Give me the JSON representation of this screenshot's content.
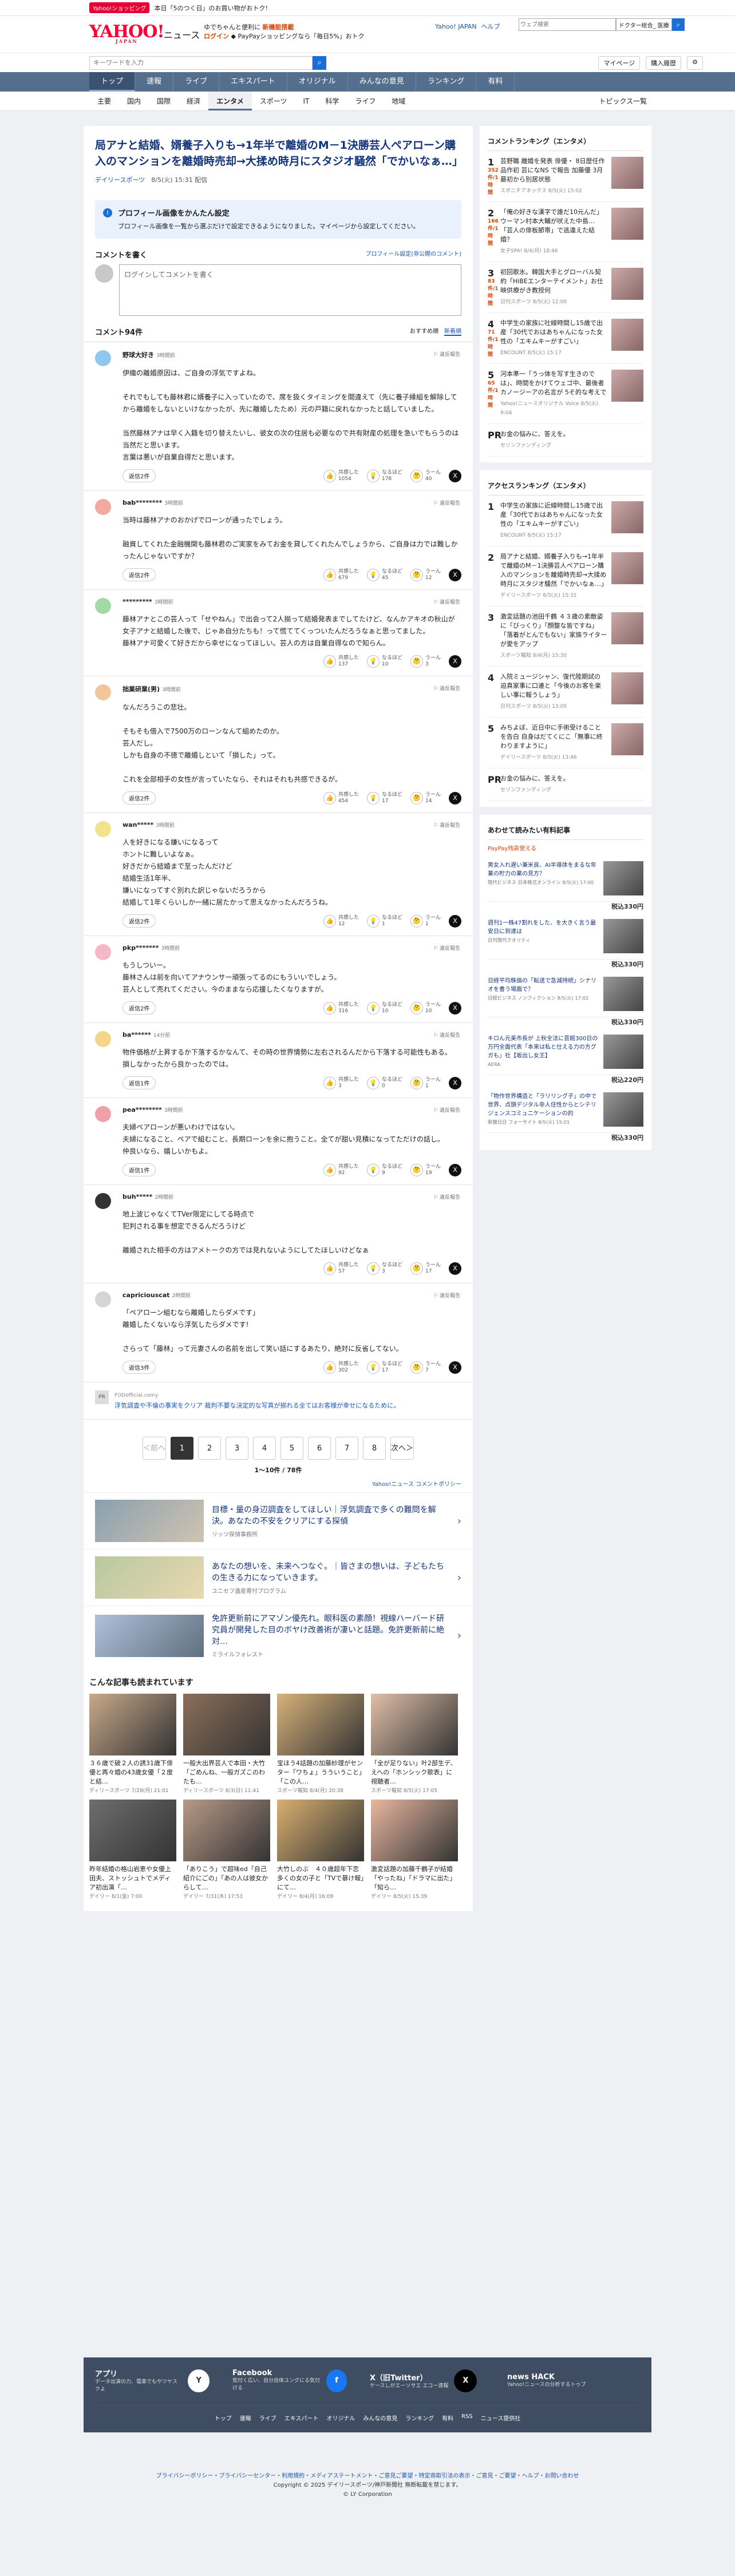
{
  "promo": {
    "tag": "Yahoo!ショッピング",
    "text": "本日「5のつく日」のお買い物がおトク!"
  },
  "header": {
    "logo": "YAHOO!",
    "logo_sub": "JAPAN",
    "service": "ニュース",
    "promo1": "ゆでちゃんと便利に",
    "promo1b": "新機能搭載",
    "promo2": "ログイン",
    "promo2b": "PayPayショッピングなら「毎日5%」おトク",
    "links": [
      "Yahoo! JAPAN",
      "ヘルプ"
    ],
    "search_placeholder": "ウェブ検索",
    "search_btn_text": "ドクター総合_ 医療"
  },
  "subbar": {
    "placeholder": "キーワードを入力",
    "mypage": "マイページ",
    "buy": "購入履歴"
  },
  "gnav": [
    "トップ",
    "速報",
    "ライブ",
    "エキスパート",
    "オリジナル",
    "みんなの意見",
    "ランキング",
    "有料"
  ],
  "cnav": [
    "主要",
    "国内",
    "国際",
    "経済",
    "エンタメ",
    "スポーツ",
    "IT",
    "科学",
    "ライフ",
    "地域"
  ],
  "cnav_topics": "トピックス一覧",
  "article": {
    "title": "局アナと結婚、婿養子入りも→1年半で離婚のM－1決勝芸人ペアローン購入のマンションを離婚時売却→大揉め時月にスタジオ騒然「でかいなぁ…」",
    "source": "デイリースポーツ",
    "date": "8/5(火) 15:31 配信"
  },
  "info": {
    "title": "プロフィール画像をかんたん設定",
    "text": "プロフィール画像を一覧から選ぶだけで設定できるようになりました。マイページから設定してください。"
  },
  "commentwrite": {
    "title": "コメントを書く",
    "link": "プロフィール設定(非公開のコメント)",
    "placeholder": "ログインしてコメントを書く"
  },
  "list": {
    "count": "コメント94件",
    "sort1": "おすすめ順",
    "sort2": "新着順"
  },
  "comments": [
    {
      "name": "野球大好き",
      "time": "3時間前",
      "text": "伊織の離婚原因は、ご自身の浮気ですよね。\n\nそれでもしても藤林君に婿養子に入っていたので、席を扱くタイミングを間違えて（先に養子縁組を解除してから離婚をしないといけなかったが、先に離婚したため）元の戸籍に戻れなかったと話していました。\n\n当然藤林アナは早く入籍を切り替えたいし、彼女の次の住居も必要なので共有財産の処理を急いでもらうのは当然だと思います。\n言葉は悪いが自業自得だと思います。",
      "reply": "返信2件",
      "a": "1054",
      "b": "178",
      "c": "40",
      "color": "#8fc7ef"
    },
    {
      "name": "bab********",
      "time": "3時間前",
      "text": "当時は藤林アナのおかげでローンが通ったでしょう。\n\n融資してくれた金融機関も藤林君のご実家をみてお金を貸してくれたんでしょうから、ご自身は力では難しかったんじゃないですか？",
      "reply": "返信2件",
      "a": "679",
      "b": "45",
      "c": "12",
      "color": "#f2a9a0"
    },
    {
      "name": "*********",
      "time": "3時間前",
      "text": "藤林アナとこの芸人って「せやねん」で出会って2人揃って結婚発表までしてたけど、なんかアキオの秋山が女子アナと結婚した後で、じゃあ自分たちも！って慌ててくっついたんだろうなぁと思ってました。\n藤林アナ可愛くて好きだから幸せになってほしい。芸人の方は自業自得なので知らん。",
      "reply": "",
      "a": "137",
      "b": "10",
      "c": "3",
      "color": "#a3d9a5"
    },
    {
      "name": "拙業研業(男)",
      "time": "3時間前",
      "text": "なんだろうこの悲壮。\n\nそもそも借入で7500万のローンなんて組めたのか。\n芸人だし。\nしかも自身の不徳で離婚しといて「損した」って。\n\nこれを全部相手の女性が言っていたなら、それはそれも共感できるが。",
      "reply": "返信2件",
      "a": "454",
      "b": "17",
      "c": "14",
      "color": "#f3c59b"
    },
    {
      "name": "wan*****",
      "time": "3時間前",
      "text": "人を好きになる嫌いになるって\nホントに難しいよなぁ。\n好きだから結婚まで至ったんだけど\n結婚生活1年半、\n嫌いになってすぐ別れた訳じゃないだろうから\n結婚して1年くらいしか一緒に居たかって思えなかったんだろうね。",
      "reply": "返信2件",
      "a": "12",
      "b": "1",
      "c": "1",
      "color": "#f1e38c"
    },
    {
      "name": "pkp*******",
      "time": "3時間前",
      "text": "もうしついー。\n藤林さんは前を向いてアナウンサー頑張ってるのにもういいでしょう。\n芸人として売れてください。今のままなら応援したくなりますが。",
      "reply": "返信2件",
      "a": "316",
      "b": "10",
      "c": "10",
      "color": "#f5b8c9"
    },
    {
      "name": "ba******",
      "time": "14分前",
      "text": "物件価格が上昇するか下落するかなんて、その時の世界情勢に左右されるんだから下落する可能性もある。\n損しなかったから良かったのでは。",
      "reply": "返信1件",
      "a": "3",
      "b": "0",
      "c": "1",
      "color": "#f5d58c"
    },
    {
      "name": "pea********",
      "time": "3時間前",
      "text": "夫婦ペアローンが悪いわけではない。\n夫婦になること、ペアで組むこと、長期ローンを余に抱うこと。全てが甜い見積になってただけの話し。\n仲良いなら、嬉しいかもよ。",
      "reply": "返信1件",
      "a": "92",
      "b": "9",
      "c": "19",
      "color": "#efa0a8"
    },
    {
      "name": "buh*****",
      "time": "2時間前",
      "text": "地上波じゃなくてTVer限定にしてる時点で\n犯判される事を想定できるんだろうけど\n\n離婚された相手の方はアメトークの方では見れないようにしてたほしいけどなぁ",
      "reply": "",
      "a": "57",
      "b": "3",
      "c": "17",
      "color": "#333333"
    },
    {
      "name": "capriciouscat",
      "time": "2時間前",
      "text": "「ペアローン組むなら離婚したらダメです」\n離婚したくないなら浮気したらダメです!\n\nさらって「藤林」って元妻さんの名前を出して笑い話にするあたり、絶対に反省してない。",
      "reply": "返信3件",
      "a": "302",
      "b": "17",
      "c": "7",
      "color": "#d5d5d5"
    }
  ],
  "ad": {
    "pr": "PR",
    "source": "FODofficial.comy",
    "text": "浮気調査や不倫の事実をクリア 裁判不要な決定的な写真が揃れる全てはお客様が幸せになるために。"
  },
  "pager": {
    "prev": "＜前へ",
    "pages": [
      "1",
      "2",
      "3",
      "4",
      "5",
      "6",
      "7",
      "8"
    ],
    "next": "次へ＞",
    "info": "1〜10件 / 78件"
  },
  "policy": "Yahoo!ニュース コメントポリシー",
  "ads": [
    {
      "title": "目標・量の身辺調査をしてほしい｜浮気調査で多くの難問を解決。あなたの不安をクリアにする探偵",
      "src": "リッツ探偵事務所"
    },
    {
      "title": "あなたの想いを、未来へつなぐ。｜皆さまの想いは、子どもたちの生きる力になっていきます。",
      "src": "ユニセフ遺産寄付プログラム"
    },
    {
      "title": "免許更新前にアマゾン優先れ。眼科医の素顔！視線ハーバード研究員が開発した目のボヤけ改善術が凄いと話題。免許更新前に絶対…",
      "src": "ミライルフォレスト"
    }
  ],
  "more": {
    "title": "こんな記事も読まれています",
    "items": [
      {
        "t": "３６歳で破２人の誘31歳下俳優と再々婚の43歳女優「２度と結…",
        "s": "ディリースポーツ",
        "d": "7/28(月) 21:01"
      },
      {
        "t": "一般大出界芸人で本田・大竹「ごめんね、一般ガズこのわたも…",
        "s": "ディリースポーツ",
        "d": "8/3(日) 11:41"
      },
      {
        "t": "宝ほう4話題の加藤紗理がセンター「ワちょ」うういうこと」「この人…",
        "s": "スポーツ報知",
        "d": "8/4(月) 20:38"
      },
      {
        "t": "「全が足りない」叶2部生デ、えへの「ホンシック歌表」に視聴者…",
        "s": "スポーツ報知",
        "d": "8/5(火) 17:05"
      },
      {
        "t": "昨年結婚の格山岩恵や女優上田夫、ストッシュトでメディア初出演「…",
        "s": "デイリー",
        "d": "8/1(金) 7:00"
      },
      {
        "t": "「ありこう」で超味ed「自己紹介にごの」「あの人は彼女からして…",
        "s": "デイリー",
        "d": "7/31(木) 17:53"
      },
      {
        "t": "大竹しのぶ　４０歳超年下恋多くの女の子と「TVで暴け報」にて…",
        "s": "デイリー",
        "d": "8/4(月) 16:09"
      },
      {
        "t": "激変話題の加藤千鶴子が結婚「やったね」「ドラマに出た」「知ら…",
        "s": "デイリー",
        "d": "8/5(火) 15:39"
      }
    ]
  },
  "ranking": {
    "title": "コメントランキング（エンタメ）",
    "items": [
      {
        "n": "1",
        "c": "352\n件/1時間",
        "t": "芸野職 離婚を発表 俳優・ 8日歴任作品作初 芸になNS で報告 加藤優 3月最初から別居状態",
        "s": "スポニチアネックス",
        "d": "8/5(火) 15:02"
      },
      {
        "n": "2",
        "c": "166\n件/1時間",
        "t": "「俺の好きな漢字で誰だ10元んだ」ウーマン村本大輔が吠えた中島…「芸人の俳板節帯」で逃違えた結婚？",
        "s": "女子SPA!",
        "d": "8/4(月) 18:46"
      },
      {
        "n": "3",
        "c": "83\n件/1時間",
        "t": "初回歌氷。韓国大手とグローバル契約「HiBEエンターテイメント」お仕映供療がき教授何",
        "s": "日刊スポーツ",
        "d": "8/5(火) 12:00"
      },
      {
        "n": "4",
        "c": "71\n件/1時間",
        "t": "中学生の家族に吐線時間し15歳で出産「30代でおはあちゃんになった女性の「エキムキーがすごい」",
        "s": "ENCOUNT",
        "d": "8/5(火) 15:17"
      },
      {
        "n": "5",
        "c": "65\n件/1時間",
        "t": "河本準一「うっ体を写す生きのでは」、時間をかけてウェゴ中、最後者カノージーアの名言が 5そ的な考えで",
        "s": "Yahoo!ニュースオリジナル Voice",
        "d": "8/5(火) 9:04"
      },
      {
        "n": "PR",
        "c": "",
        "t": "お金の悩みに、答えを。",
        "s": "セゾンファンディング",
        "d": ""
      }
    ]
  },
  "access": {
    "title": "アクセスランキング（エンタメ）",
    "items": [
      {
        "n": "1",
        "t": "中学生の家族に近線時間し15歳で出産「30代でおはあちゃんになった女性の「エキムキーがすごい」",
        "s": "ENCOUNT",
        "d": "8/5(火) 15:17"
      },
      {
        "n": "2",
        "t": "局アナと結婚、婿養子入りも→1年半で離婚のM－1決勝芸人ペアローン購入のマンションを離婚時売却→大揉め時月にスタジオ騒然「でかいなぁ…」",
        "s": "デイリースポーツ",
        "d": "8/5(火) 15:31"
      },
      {
        "n": "3",
        "t": "激変話題の池田千鶴 ４３歳の素敵姿に「びっくり」「顔整な皆ですね」「落着がとんでもない」家族ライターが愛をアップ",
        "s": "スポーツ報知",
        "d": "8/4(月) 15:30"
      },
      {
        "n": "4",
        "t": "入院ミュージシャン、復代陸期試の迫真家事に口連と「今後のお客を楽しい事に報うしょう」",
        "s": "日刊スポーツ",
        "d": "8/5(火) 13:05"
      },
      {
        "n": "5",
        "t": "みちよぼ、近日中に手術受けることを告白 自身はだてくにこ「無事に終わりますように」",
        "s": "デイリースポーツ",
        "d": "8/5(火) 13:46"
      },
      {
        "n": "PR",
        "t": "お金の悩みに、答えを。",
        "s": "セゾンファンディング",
        "d": ""
      }
    ]
  },
  "shop": {
    "title": "あわせて読みたい有料記事",
    "sub": "PayPay残高使える",
    "items": [
      {
        "t": "男女入れ遅い兼米良、AI半導体をまるな年業の貯力の業の見方？",
        "s": "現代ビジネス 日本株式オンライン 8/5(火) 17:00",
        "p": "税込330円"
      },
      {
        "t": "週刊1一株47割れをした、を大きく言う最安日に到達は",
        "s": "日刊現代クオリティ",
        "p": "税込330円"
      },
      {
        "t": "日経平均株価の「転送で急減持続」シナリオを書う場面で？",
        "s": "日経ビジネス ノンフィクション 8/5(火) 17:02",
        "p": "税込330円"
      },
      {
        "t": "キロん元美市長が 上秋全法に芸館300日の万円全面代表「本来は私と仕える力の方グガも」社【坂出し女王】",
        "s": "AERA",
        "p": "税込220円"
      },
      {
        "t": "「物作世界構造と「ラリリング子」の中で世界、点頭デジタル非人住性からとシテリジェンスコミュニケーションの的",
        "s": "新聞日日 フォーサイト 8/5(火) 15:01",
        "p": "税込330円"
      }
    ]
  },
  "footer": {
    "apps": [
      {
        "h": "アプリ",
        "p": "データ出演の力、電車でもやツヤスクよ"
      },
      {
        "h": "Facebook",
        "p": "気付く広い、自分自体ユングにる気付ける"
      },
      {
        "h": "X（旧Twitter）",
        "p": "ケースしがエーソサエ エコー速報"
      },
      {
        "h": "news HACK",
        "p": "Yahoo!ニュースの分析するトゥブ"
      }
    ],
    "nav": [
      "トップ",
      "速報",
      "ライブ",
      "エキスパート",
      "オリジナル",
      "みんなの意見",
      "ランキング",
      "有料",
      "RSS",
      "ニュース提供社"
    ],
    "links": "プライバシーポリシー・プライバシーセンター・利用規約・メディアステートメント・ご意見ご要望・特定商取引法の表示・ご意見・ご要望・ヘルプ・お問い合わせ",
    "copy1": "Copyright © 2025 デイリースポーツ/神戸新聞社 無断転載を禁じます。",
    "copy2": "© LY Corporation"
  }
}
